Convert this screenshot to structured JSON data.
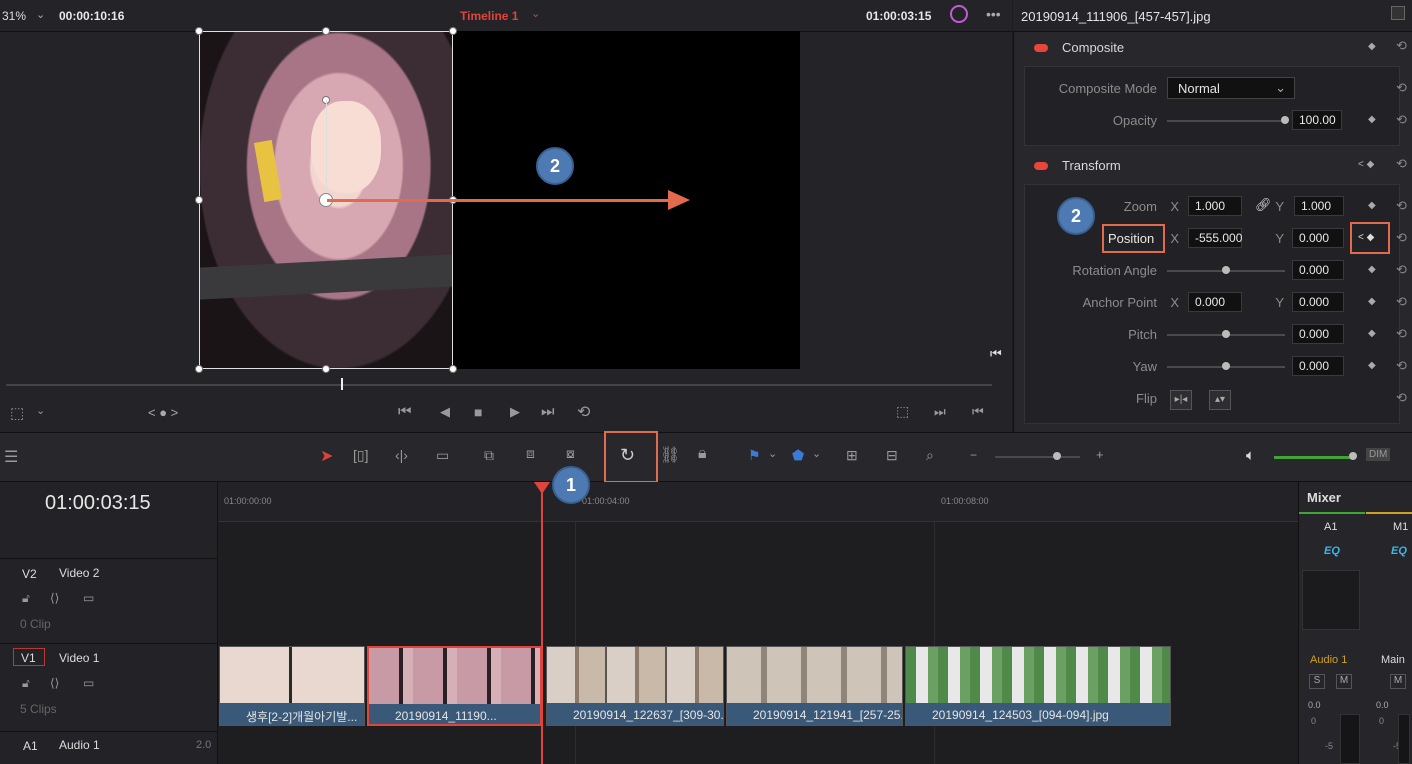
{
  "viewer": {
    "zoom": "31%",
    "source_timecode": "00:00:10:16",
    "timeline_name": "Timeline 1",
    "record_timecode": "01:00:03:15",
    "nav_dots": "< ● >"
  },
  "annotations": {
    "badge1": "1",
    "badge2_viewer": "2",
    "badge2_inspector": "2"
  },
  "inspector": {
    "clip_name": "20190914_111906_[457-457].jpg",
    "composite": {
      "header": "Composite",
      "mode_label": "Composite Mode",
      "mode_value": "Normal",
      "opacity_label": "Opacity",
      "opacity_value": "100.00",
      "opacity_level": 1.0
    },
    "transform": {
      "header": "Transform",
      "zoom_label": "Zoom",
      "zoom_x": "1.000",
      "zoom_y": "1.000",
      "position_label": "Position",
      "position_x": "-555.000",
      "position_y": "0.000",
      "rotation_label": "Rotation Angle",
      "rotation_value": "0.000",
      "anchor_label": "Anchor Point",
      "anchor_x": "0.000",
      "anchor_y": "0.000",
      "pitch_label": "Pitch",
      "pitch_value": "0.000",
      "yaw_label": "Yaw",
      "yaw_value": "0.000",
      "flip_label": "Flip",
      "x_axis": "X",
      "y_axis": "Y"
    }
  },
  "timeline": {
    "timecode": "01:00:03:15",
    "ruler_ticks": [
      "01:00:00:00",
      "01:00:04:00",
      "01:00:08:00"
    ],
    "tracks": [
      {
        "id": "V2",
        "name": "Video 2",
        "count": "0 Clip"
      },
      {
        "id": "V1",
        "name": "Video 1",
        "count": "5 Clips"
      },
      {
        "id": "A1",
        "name": "Audio 1",
        "channels": "2.0"
      }
    ],
    "clips": [
      {
        "label": "생후[2-2]개월아기발..."
      },
      {
        "label": "20190914_11190..."
      },
      {
        "label": "20190914_122637_[309-30..."
      },
      {
        "label": "20190914_121941_[257-25..."
      },
      {
        "label": "20190914_124503_[094-094].jpg"
      }
    ]
  },
  "mixer": {
    "title": "Mixer",
    "ch1": "A1",
    "ch2": "M1",
    "eq": "EQ",
    "strip1": "Audio 1",
    "strip2": "Main",
    "s": "S",
    "m": "M",
    "db": "0.0",
    "db2": "0",
    "db3": "-5",
    "dim": "DIM"
  },
  "colors": {
    "accent_red": "#e26b4d",
    "badge_blue": "#4d7ab3",
    "playhead": "#e0443a",
    "timeline_name": "#e0443a"
  }
}
